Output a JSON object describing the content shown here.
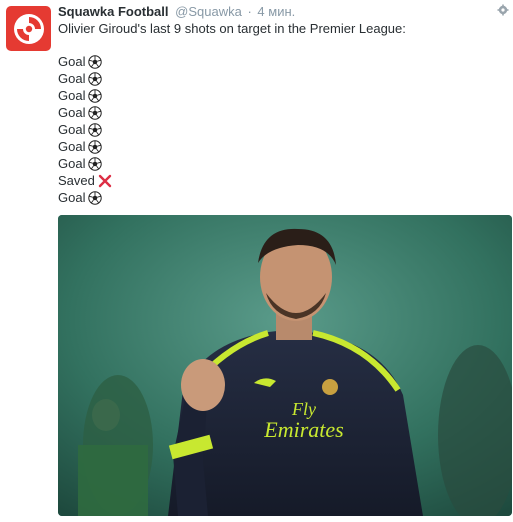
{
  "tweet": {
    "name": "Squawka Football",
    "handle": "@Squawka",
    "separator": "·",
    "time": "4 мин.",
    "text": "Olivier Giroud's last 9 shots on target in the Premier League:",
    "results": [
      {
        "label": "Goal",
        "icon": "soccer-ball-icon"
      },
      {
        "label": "Goal",
        "icon": "soccer-ball-icon"
      },
      {
        "label": "Goal",
        "icon": "soccer-ball-icon"
      },
      {
        "label": "Goal",
        "icon": "soccer-ball-icon"
      },
      {
        "label": "Goal",
        "icon": "soccer-ball-icon"
      },
      {
        "label": "Goal",
        "icon": "soccer-ball-icon"
      },
      {
        "label": "Goal",
        "icon": "soccer-ball-icon"
      },
      {
        "label": "Saved",
        "icon": "cross-mark-icon"
      },
      {
        "label": "Goal",
        "icon": "soccer-ball-icon"
      }
    ],
    "jersey_text": [
      "Fly",
      "Emirates"
    ],
    "colors": {
      "avatar": "#e53a32",
      "cross": "#dd2e44",
      "kit_accent": "#c8e830",
      "kit_navy": "#1c2336"
    }
  }
}
